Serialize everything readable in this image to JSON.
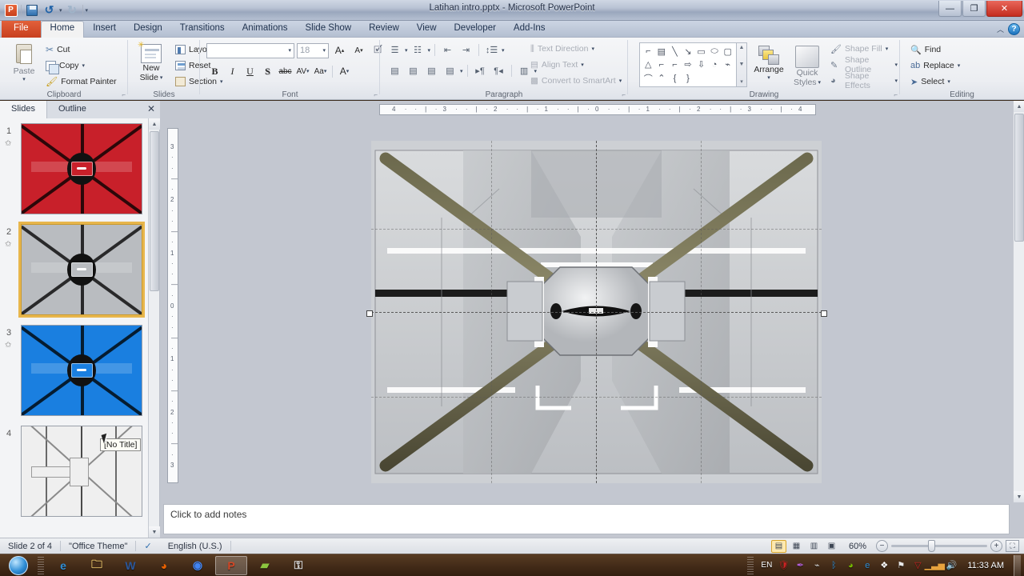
{
  "window": {
    "title": "Latihan intro.pptx  -  Microsoft PowerPoint",
    "minimize": "—",
    "restore": "❐",
    "close": "✕",
    "app_logo": "P"
  },
  "qat": {
    "save_tip": "save-icon",
    "undo": "↺",
    "redo": "↻",
    "more": "▾"
  },
  "ribbon": {
    "help": "?",
    "collapse": "︿",
    "tabs": [
      {
        "label": "File",
        "active": false,
        "file": true
      },
      {
        "label": "Home",
        "active": true,
        "file": false
      },
      {
        "label": "Insert",
        "active": false,
        "file": false
      },
      {
        "label": "Design",
        "active": false,
        "file": false
      },
      {
        "label": "Transitions",
        "active": false,
        "file": false
      },
      {
        "label": "Animations",
        "active": false,
        "file": false
      },
      {
        "label": "Slide Show",
        "active": false,
        "file": false
      },
      {
        "label": "Review",
        "active": false,
        "file": false
      },
      {
        "label": "View",
        "active": false,
        "file": false
      },
      {
        "label": "Developer",
        "active": false,
        "file": false
      },
      {
        "label": "Add-Ins",
        "active": false,
        "file": false
      }
    ],
    "groups": {
      "clipboard": {
        "label": "Clipboard",
        "paste": "Paste",
        "cut": "Cut",
        "copy": "Copy",
        "format_painter": "Format Painter"
      },
      "slides": {
        "label": "Slides",
        "new_slide": "New\nSlide",
        "new_slide_l1": "New",
        "new_slide_l2": "Slide",
        "layout": "Layout",
        "reset": "Reset",
        "section": "Section"
      },
      "font": {
        "label": "Font",
        "font_name": "",
        "font_size": "18",
        "bold": "B",
        "italic": "I",
        "underline": "U",
        "shadow": "S",
        "strikethrough": "abc",
        "char_spacing": "AV",
        "change_case": "Aa",
        "font_color": "A",
        "grow_font": "A",
        "shrink_font": "A",
        "clear_formatting": "Aa"
      },
      "paragraph": {
        "label": "Paragraph",
        "text_direction": "Text Direction",
        "align_text": "Align Text",
        "convert_smartart": "Convert to SmartArt"
      },
      "drawing": {
        "label": "Drawing",
        "arrange": "Arrange",
        "quick_styles_l1": "Quick",
        "quick_styles_l2": "Styles",
        "shape_fill": "Shape Fill",
        "shape_outline": "Shape Outline",
        "shape_effects": "Shape Effects",
        "shapes": [
          "⌐",
          "▤",
          "╲",
          "↘",
          "▭",
          "⬭",
          "▢",
          "△",
          "⌐",
          "⌐",
          "⇨",
          "⇩",
          "◔",
          "⌁",
          "⌒",
          "⌃",
          "{",
          "}"
        ]
      },
      "editing": {
        "label": "Editing",
        "find": "Find",
        "replace": "Replace",
        "select": "Select"
      }
    }
  },
  "slides_pane": {
    "tab_slides": "Slides",
    "tab_outline": "Outline",
    "close": "✕",
    "thumbnails": [
      {
        "number": "1",
        "color": "#c8202a",
        "selected": false,
        "has_animation": true,
        "title": ""
      },
      {
        "number": "2",
        "color": "#b9bcc0",
        "selected": true,
        "has_animation": true,
        "title": ""
      },
      {
        "number": "3",
        "color": "#1a7fe0",
        "selected": false,
        "has_animation": true,
        "title": ""
      },
      {
        "number": "4",
        "color": "#eeeeee",
        "selected": false,
        "has_animation": false,
        "title": "[No Title]"
      }
    ],
    "tooltip": "[No Title]"
  },
  "rulers": {
    "horizontal": [
      "4",
      "3",
      "2",
      "1",
      "0",
      "1",
      "2",
      "3",
      "4"
    ],
    "vertical": [
      "3",
      "2",
      "1",
      "0",
      "1",
      "2",
      "3"
    ]
  },
  "notes": {
    "placeholder": "Click to add notes"
  },
  "status_bar": {
    "slide_indicator": "Slide 2 of 4",
    "theme": "\"Office Theme\"",
    "language": "English (U.S.)",
    "spell_icon": "spell-check-icon",
    "zoom_level": "60%",
    "zoom_out": "−",
    "zoom_in": "+",
    "fit_slide": "⛶",
    "views": [
      {
        "name": "normal",
        "glyph": "▤",
        "active": true
      },
      {
        "name": "slide-sorter",
        "glyph": "▦",
        "active": false
      },
      {
        "name": "reading",
        "glyph": "▥",
        "active": false
      },
      {
        "name": "slide-show",
        "glyph": "▣",
        "active": false
      }
    ]
  },
  "taskbar": {
    "start": "start-orb",
    "buttons": [
      {
        "name": "internet-explorer",
        "glyph": "e",
        "color": "#2f8ed6",
        "active": false
      },
      {
        "name": "windows-explorer",
        "glyph": "🗀",
        "color": "#e8c36a",
        "active": false
      },
      {
        "name": "microsoft-word",
        "glyph": "W",
        "color": "#2b579a",
        "active": false
      },
      {
        "name": "mozilla-firefox",
        "glyph": "◕",
        "color": "#e66000",
        "active": false
      },
      {
        "name": "google-chrome",
        "glyph": "◉",
        "color": "#4285f4",
        "active": false
      },
      {
        "name": "microsoft-powerpoint",
        "glyph": "P",
        "color": "#d24726",
        "active": true
      },
      {
        "name": "green-app",
        "glyph": "▰",
        "color": "#8cc63f",
        "active": false
      },
      {
        "name": "key-app",
        "glyph": "⚿",
        "color": "#d8d8d8",
        "active": false
      }
    ],
    "language_indicator": "EN",
    "tray": [
      {
        "name": "security-shield",
        "glyph": "🛡",
        "color": "#cc2222"
      },
      {
        "name": "stylus-pen",
        "glyph": "✒",
        "color": "#b15ed6"
      },
      {
        "name": "network-antenna",
        "glyph": "⌁",
        "color": "#cfcfcf"
      },
      {
        "name": "bluetooth",
        "glyph": "ᛒ",
        "color": "#2f8ed6"
      },
      {
        "name": "nvidia-settings",
        "glyph": "◕",
        "color": "#76b900"
      },
      {
        "name": "internet-explorer-tray",
        "glyph": "e",
        "color": "#2f8ed6"
      },
      {
        "name": "dropbox",
        "glyph": "❖",
        "color": "#ffffff"
      },
      {
        "name": "flag-error",
        "glyph": "⚑",
        "color": "#e8e8e8"
      },
      {
        "name": "antivirus",
        "glyph": "▽",
        "color": "#cc2222"
      },
      {
        "name": "volume-meter",
        "glyph": "▁▃▅",
        "color": "#e8a33d"
      },
      {
        "name": "speaker",
        "glyph": "🔊",
        "color": "#e8e8e8"
      }
    ],
    "clock": "11:33 AM"
  }
}
